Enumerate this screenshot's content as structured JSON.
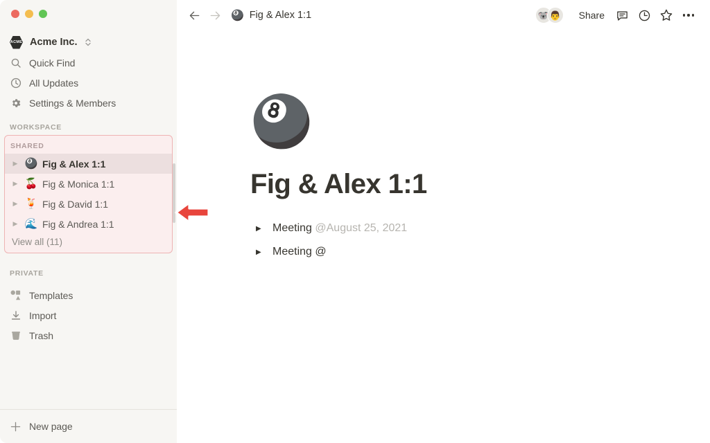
{
  "window": {
    "traffic_lights": [
      "close",
      "minimize",
      "maximize"
    ]
  },
  "sidebar": {
    "workspace": {
      "logo_text": "ACME",
      "name": "Acme Inc.",
      "switcher_icon": "chevron-up-down-icon"
    },
    "nav_items": [
      {
        "label": "Quick Find",
        "icon": "search-icon"
      },
      {
        "label": "All Updates",
        "icon": "clock-icon"
      },
      {
        "label": "Settings & Members",
        "icon": "gear-icon"
      }
    ],
    "workspace_label": "WORKSPACE",
    "shared": {
      "label": "SHARED",
      "highlight_border_color": "#eeb3b3",
      "highlight_fill_color": "#fbeeee",
      "pages": [
        {
          "emoji": "🎱",
          "label": "Fig & Alex 1:1",
          "selected": true
        },
        {
          "emoji": "🍒",
          "label": "Fig & Monica 1:1",
          "selected": false
        },
        {
          "emoji": "🍹",
          "label": "Fig & David 1:1",
          "selected": false
        },
        {
          "emoji": "🌊",
          "label": "Fig & Andrea 1:1",
          "selected": false
        }
      ],
      "view_all": "View all (11)"
    },
    "private_label": "PRIVATE",
    "private_items": [
      {
        "label": "Templates",
        "icon": "templates-shapes-icon"
      },
      {
        "label": "Import",
        "icon": "download-arrow-icon"
      },
      {
        "label": "Trash",
        "icon": "trash-can-icon"
      }
    ],
    "new_page": {
      "label": "New page",
      "icon": "plus-icon"
    }
  },
  "topbar": {
    "back_icon": "arrow-left-icon",
    "forward_icon": "arrow-right-icon",
    "breadcrumb": {
      "emoji": "🎱",
      "title": "Fig & Alex 1:1"
    },
    "avatars": [
      {
        "name": "koala-avatar",
        "glyph": "🐨"
      },
      {
        "name": "person-avatar",
        "glyph": "👨"
      }
    ],
    "share_label": "Share",
    "icons": [
      {
        "name": "comment-icon"
      },
      {
        "name": "history-clock-icon"
      },
      {
        "name": "favorite-star-icon"
      },
      {
        "name": "more-options-icon"
      }
    ]
  },
  "document": {
    "emoji": "🎱",
    "title": "Fig & Alex 1:1",
    "blocks": [
      {
        "type": "toggle",
        "text": "Meeting ",
        "mention": "@August 25, 2021"
      },
      {
        "type": "toggle",
        "text": "Meeting @",
        "mention": ""
      }
    ]
  },
  "annotation": {
    "arrow": {
      "direction": "left",
      "color": "#e8453c",
      "target": "shared-pages-group"
    }
  }
}
